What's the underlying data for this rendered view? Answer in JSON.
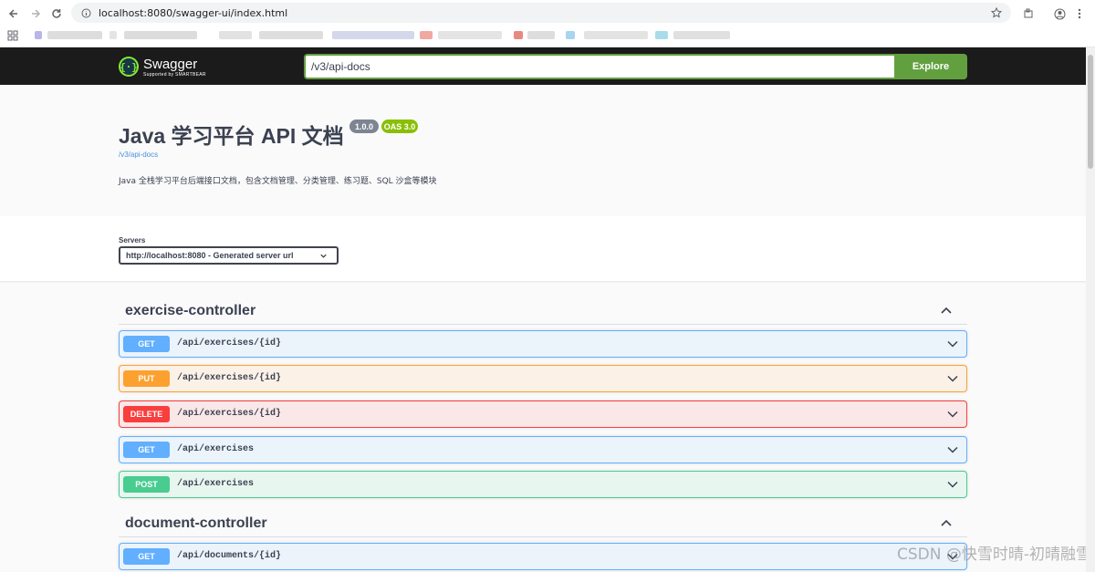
{
  "browser": {
    "url": "localhost:8080/swagger-ui/index.html"
  },
  "topbar": {
    "logo_text": "Swagger",
    "logo_sub": "Supported by SMARTBEAR",
    "spec_url": "/v3/api-docs",
    "explore_label": "Explore"
  },
  "info": {
    "title": "Java 学习平台 API 文档",
    "version": "1.0.0",
    "oas": "OAS 3.0",
    "spec_link": "/v3/api-docs",
    "description": "Java 全栈学习平台后端接口文档，包含文档管理、分类管理、练习题、SQL 沙盒等模块"
  },
  "servers": {
    "label": "Servers",
    "selected": "http://localhost:8080 - Generated server url"
  },
  "tags": [
    {
      "name": "exercise-controller",
      "operations": [
        {
          "method": "GET",
          "path": "/api/exercises/{id}"
        },
        {
          "method": "PUT",
          "path": "/api/exercises/{id}"
        },
        {
          "method": "DELETE",
          "path": "/api/exercises/{id}"
        },
        {
          "method": "GET",
          "path": "/api/exercises"
        },
        {
          "method": "POST",
          "path": "/api/exercises"
        }
      ]
    },
    {
      "name": "document-controller",
      "operations": [
        {
          "method": "GET",
          "path": "/api/documents/{id}"
        }
      ]
    }
  ],
  "watermark": "CSDN @快雪时晴-初晴融雪",
  "colors": {
    "get": "#61affe",
    "put": "#fca130",
    "delete": "#f93e3e",
    "post": "#49cc90",
    "topbar": "#1b1b1b",
    "explore": "#62a03f"
  }
}
